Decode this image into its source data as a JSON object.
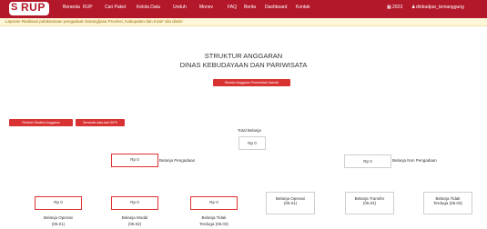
{
  "nav": {
    "logo": "RUP",
    "items": [
      "Beranda",
      "RUP",
      "Cari Paket",
      "Kelola Data",
      "Unduh",
      "Monev",
      "FAQ",
      "Berita",
      "Dashboard",
      "Kontak"
    ],
    "year": "2023",
    "user": "dinbudpar_temanggung"
  },
  "alert": {
    "text": "Laporan Realisasi pelaksanaan pengadaan barang/jasa Provinsi, Kabupaten dan Kota* sila disini!"
  },
  "page": {
    "title_line1": "STRUKTUR ANGGARAN",
    "title_line2": "DINAS KEBUDAYAAN DAN PARIWISATA",
    "structure_button": "Struktur Anggaran Pemerintah Daerah",
    "btn_refresh": "Refresh Struktur Anggaran",
    "btn_generate": "Generate data dari SIPD"
  },
  "tree": {
    "total_label": "Total Belanja",
    "total_value": "Rp 0",
    "pengadaan_value": "Rp 0",
    "pengadaan_label": "Belanja Pengadaan",
    "non_pengadaan_value": "Rp 0",
    "non_pengadaan_label": "Belanja Non Pengadaan",
    "leaves_left": [
      {
        "value": "Rp 0",
        "label1": "Belanja Operasi",
        "label2": "(05.01)"
      },
      {
        "value": "Rp 0",
        "label1": "Belanja Modal",
        "label2": "(05.02)"
      },
      {
        "value": "Rp 0",
        "label1": "Belanja Tidak",
        "label2": "Terduga (05.03)"
      }
    ],
    "leaves_right": [
      {
        "label1": "Belanja Operasi",
        "label2": "(05.01)"
      },
      {
        "label1": "Belanja Transfer",
        "label2": "(05.04)"
      },
      {
        "label1": "Belanja Tidak",
        "label2": "Terduga (05.03)"
      }
    ]
  }
}
